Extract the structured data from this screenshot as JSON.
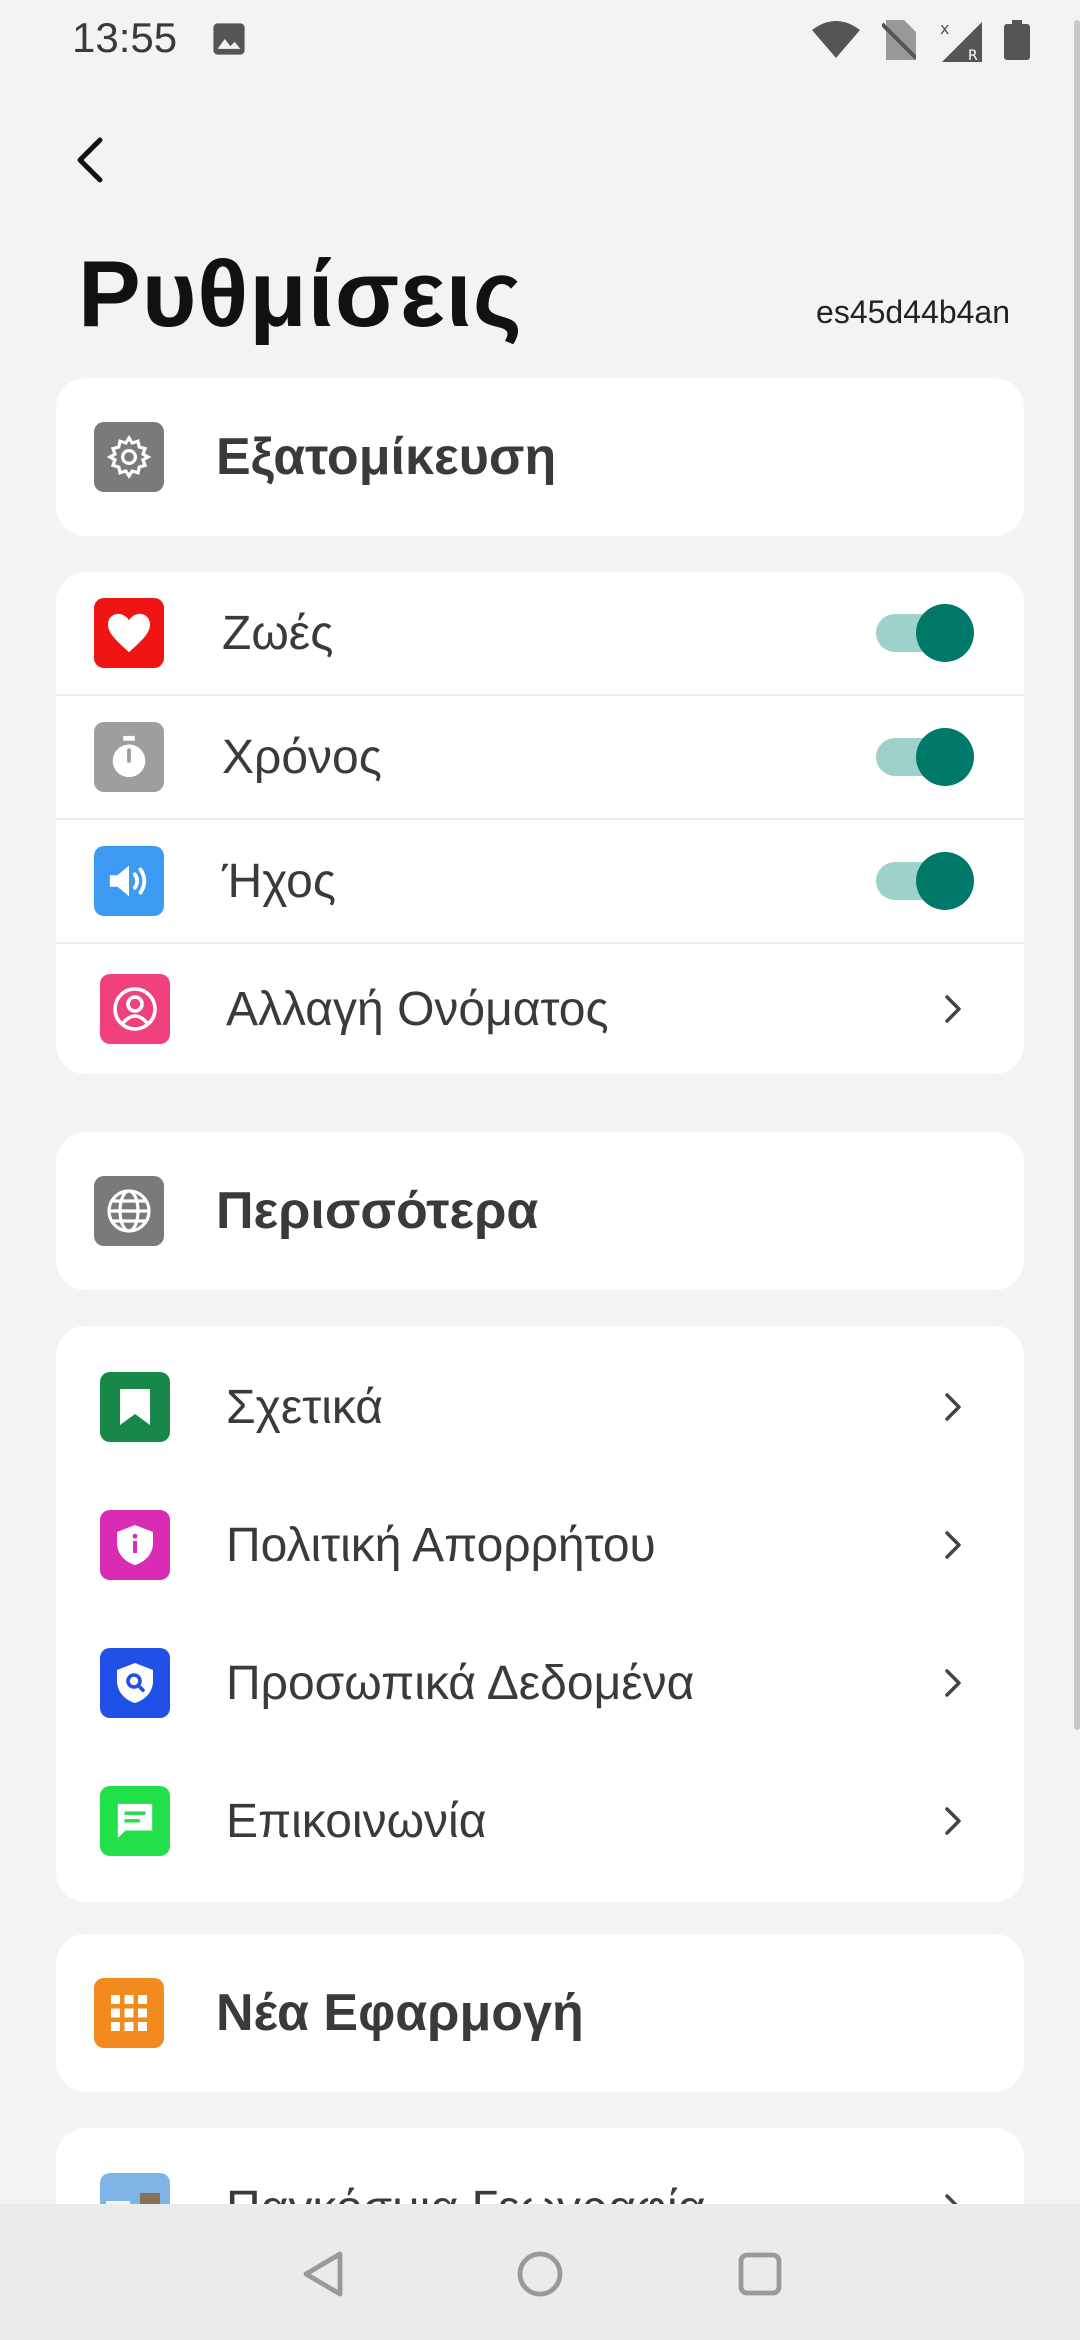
{
  "status_bar": {
    "time": "13:55"
  },
  "header": {
    "title": "Ρυθμίσεις",
    "device_id": "es45d44b4an"
  },
  "sections": {
    "personalization": {
      "title": "Εξατομίκευση"
    },
    "settings": {
      "lives": {
        "label": "Ζωές",
        "enabled": true,
        "icon": "heart-icon",
        "color": "#f01414"
      },
      "time": {
        "label": "Χρόνος",
        "enabled": true,
        "icon": "stopwatch-icon",
        "color": "#9e9e9e"
      },
      "sound": {
        "label": "Ήχος",
        "enabled": true,
        "icon": "speaker-icon",
        "color": "#3d9bf3"
      },
      "change_name": {
        "label": "Αλλαγή Ονόματος",
        "icon": "user-icon",
        "color": "#f0417c"
      }
    },
    "more": {
      "title": "Περισσότερα"
    },
    "links": {
      "about": {
        "label": "Σχετικά",
        "icon": "bookmark-icon",
        "color": "#17874a"
      },
      "privacy": {
        "label": "Πολιτική Απορρήτου",
        "icon": "shield-info-icon",
        "color": "#d92cb4"
      },
      "personal_data": {
        "label": "Προσωπικά Δεδομένα",
        "icon": "shield-search-icon",
        "color": "#2050e8"
      },
      "contact": {
        "label": "Επικοινωνία",
        "icon": "chat-icon",
        "color": "#22e04a"
      }
    },
    "new_app": {
      "title": "Νέα Εφαρμογή",
      "color": "#f28a1e"
    },
    "apps": {
      "world_geography": {
        "label": "Παγκόσμια Γεωγραφία"
      }
    }
  },
  "colors": {
    "toggle_on": "#00796b",
    "toggle_track": "#9fd1cb",
    "background": "#f3f3f3"
  }
}
